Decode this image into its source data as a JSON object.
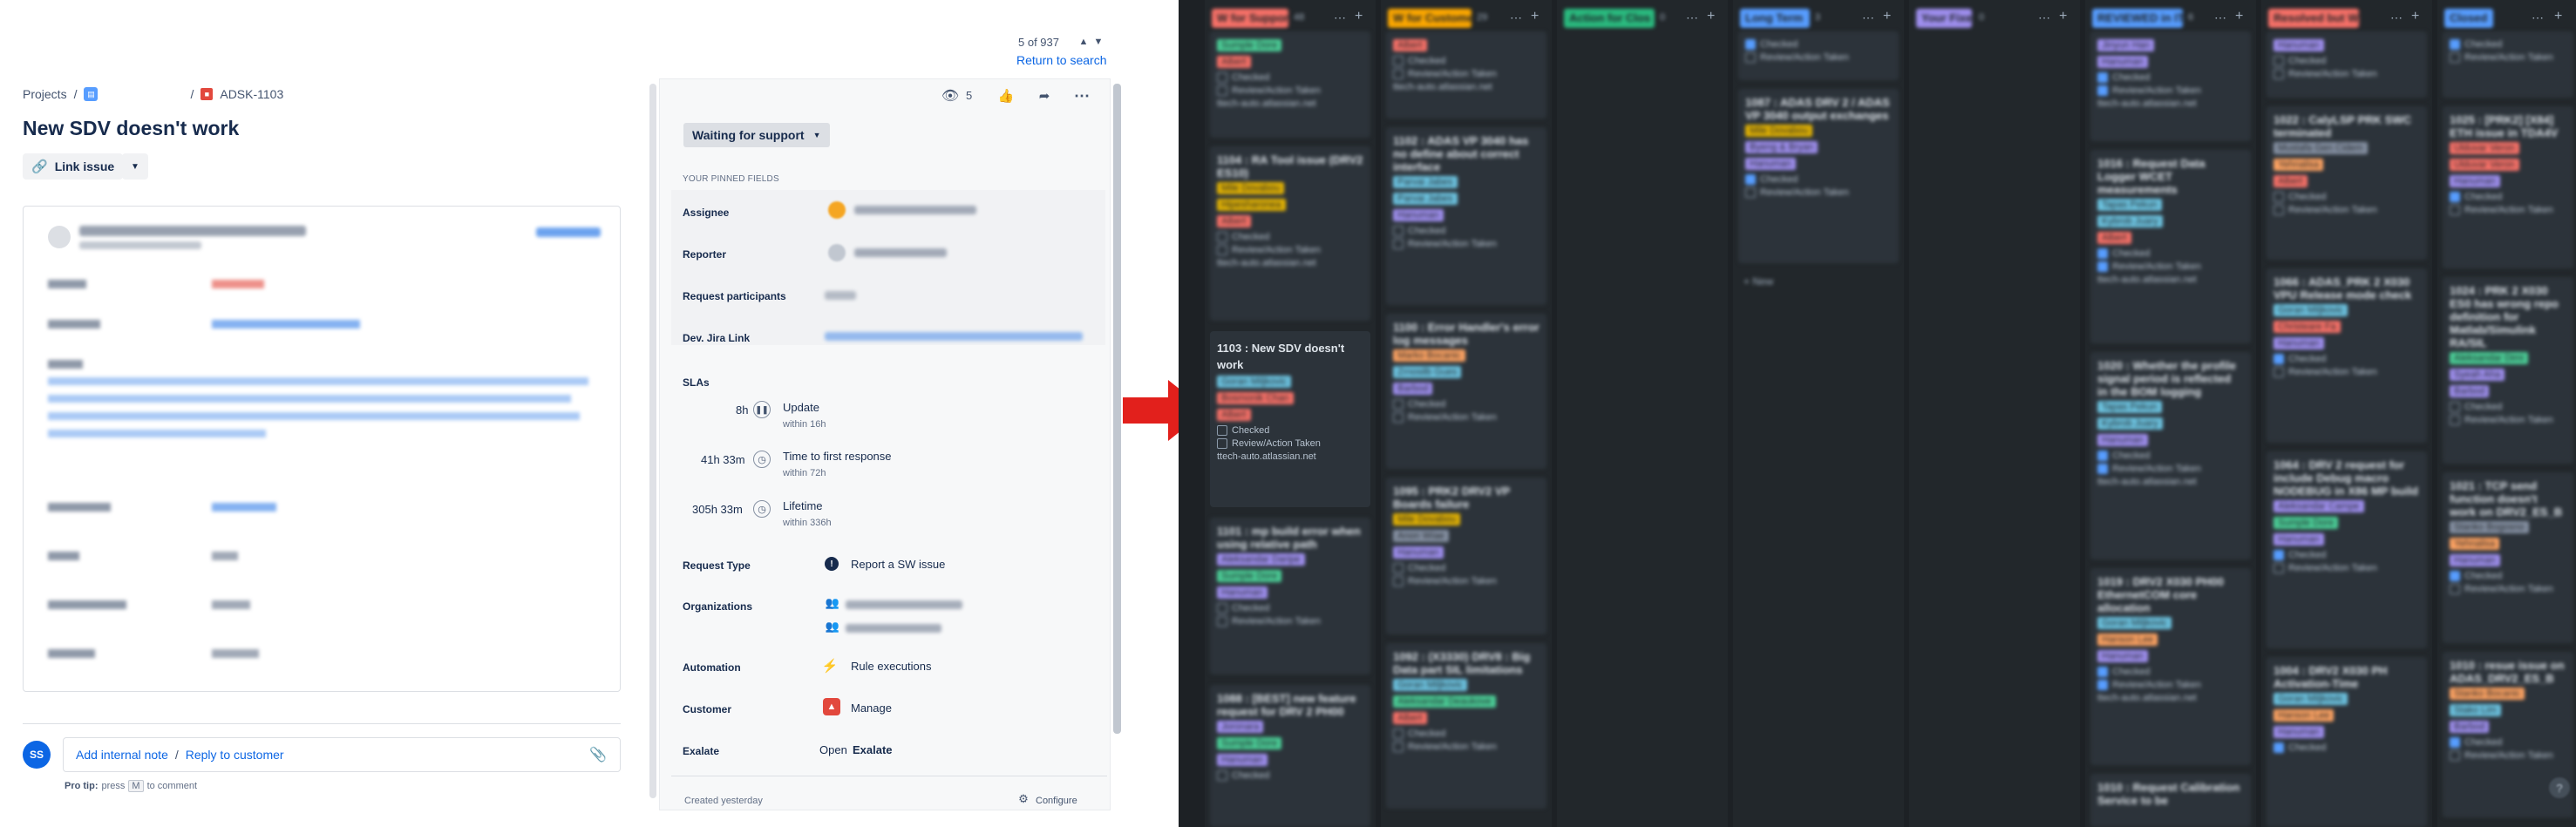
{
  "issue": {
    "pager": "5 of 937",
    "return_link": "Return to search",
    "breadcrumb_projects": "Projects",
    "breadcrumb_sep": "/",
    "issue_key": "ADSK-1103",
    "title": "New SDV doesn't work",
    "link_issue": "Link issue",
    "status": "Waiting for support",
    "watchers": "5",
    "pinned_header": "YOUR PINNED FIELDS",
    "fields": {
      "assignee": "Assignee",
      "reporter": "Reporter",
      "request_participants": "Request participants",
      "dev_jira_link": "Dev. Jira Link",
      "slas": "SLAs",
      "request_type": "Request Type",
      "request_type_value": "Report a SW issue",
      "organizations": "Organizations",
      "automation": "Automation",
      "automation_value": "Rule executions",
      "customer": "Customer",
      "customer_value": "Manage",
      "exalate": "Exalate",
      "exalate_open": "Open",
      "exalate_value": "Exalate"
    },
    "slas": [
      {
        "time": "8h",
        "name": "Update",
        "sub": "within 16h"
      },
      {
        "time": "41h 33m",
        "name": "Time to first response",
        "sub": "within 72h"
      },
      {
        "time": "305h 33m",
        "name": "Lifetime",
        "sub": "within 336h"
      }
    ],
    "comment": {
      "avatar": "SS",
      "add_internal_note": "Add internal note",
      "sep": "/",
      "reply": "Reply to customer",
      "pro_tip_label": "Pro tip:",
      "pro_tip_press": "press",
      "pro_tip_key": "M",
      "pro_tip_rest": "to comment"
    },
    "created": "Created yesterday",
    "configure": "Configure"
  },
  "board": {
    "columns": [
      {
        "name": "W for Support",
        "count": "48",
        "color": "#f87168"
      },
      {
        "name": "W for Custome",
        "count": "29",
        "color": "#fca700"
      },
      {
        "name": "Action for Clos",
        "count": "0",
        "color": "#2abb7f"
      },
      {
        "name": "Long Term",
        "count": "3",
        "color": "#579dff"
      },
      {
        "name": "Your Fixe",
        "count": "0",
        "color": "#9f8fef"
      },
      {
        "name": "REVIEWED in IT",
        "count": "6",
        "color": "#579dff"
      },
      {
        "name": "Resolved but W",
        "count": "",
        "color": "#f87168"
      },
      {
        "name": "Closed",
        "count": "",
        "color": "#579dff"
      }
    ],
    "checked_label": "Checked",
    "review_label": "Review/Action Taken",
    "highlight_card_title": "1103 : New SDV doesn't work",
    "highlight_url": "ttech-auto.atlassian.net",
    "new_label": "+ New",
    "card_titles": [
      "1104 : RA Tool issue (DRV2 ES10)",
      "1102 : ADAS VP 3040 has no define about correct interface",
      "1100 : Error Handler's error log messages",
      "1095 : PRK2 DRV2 VP Boards failure",
      "1101 : mp build error when using relative path",
      "1092 : (X3330) DRV8 : Big Data part SIL limitations",
      "1088 : [BEST] new feature request for DRV 2 PH00",
      "1087 : ADAS DRV 2 / ADAS VP 3040 output exchanges",
      "1016 : Request Data Logger WCET measurements",
      "1020 : Whether the profile signal period is reflected in the BOM logging",
      "1019 : DRV2 X030 PH00 EthernetCOM core allocation",
      "1010 : Request Calibration Service to be",
      "1022 : CalyLSP PRK SWC terminated",
      "1066 : ADAS_PRK 2 X030 VPU Release mode check",
      "1064 : DRV 2 request for include Debug macro NODEBUG in X86 MP build",
      "1004 : DRV2 X030 PH Activation-Time",
      "1025 : [PRK2] [X84] ETH issue in TDA4V",
      "1024 : PRK 2 X030 ES0 has wrong repo definition for Matlab/Simulink RA/SIL",
      "1021 : TCP send function doesn't work on DRV2_ES_B",
      "1010 : resue issue on ADAS_DRV2_ES_B"
    ]
  },
  "colors": {
    "link": "#0c66e4",
    "board_bg": "#1d2125",
    "arrow": "#e2201c"
  }
}
